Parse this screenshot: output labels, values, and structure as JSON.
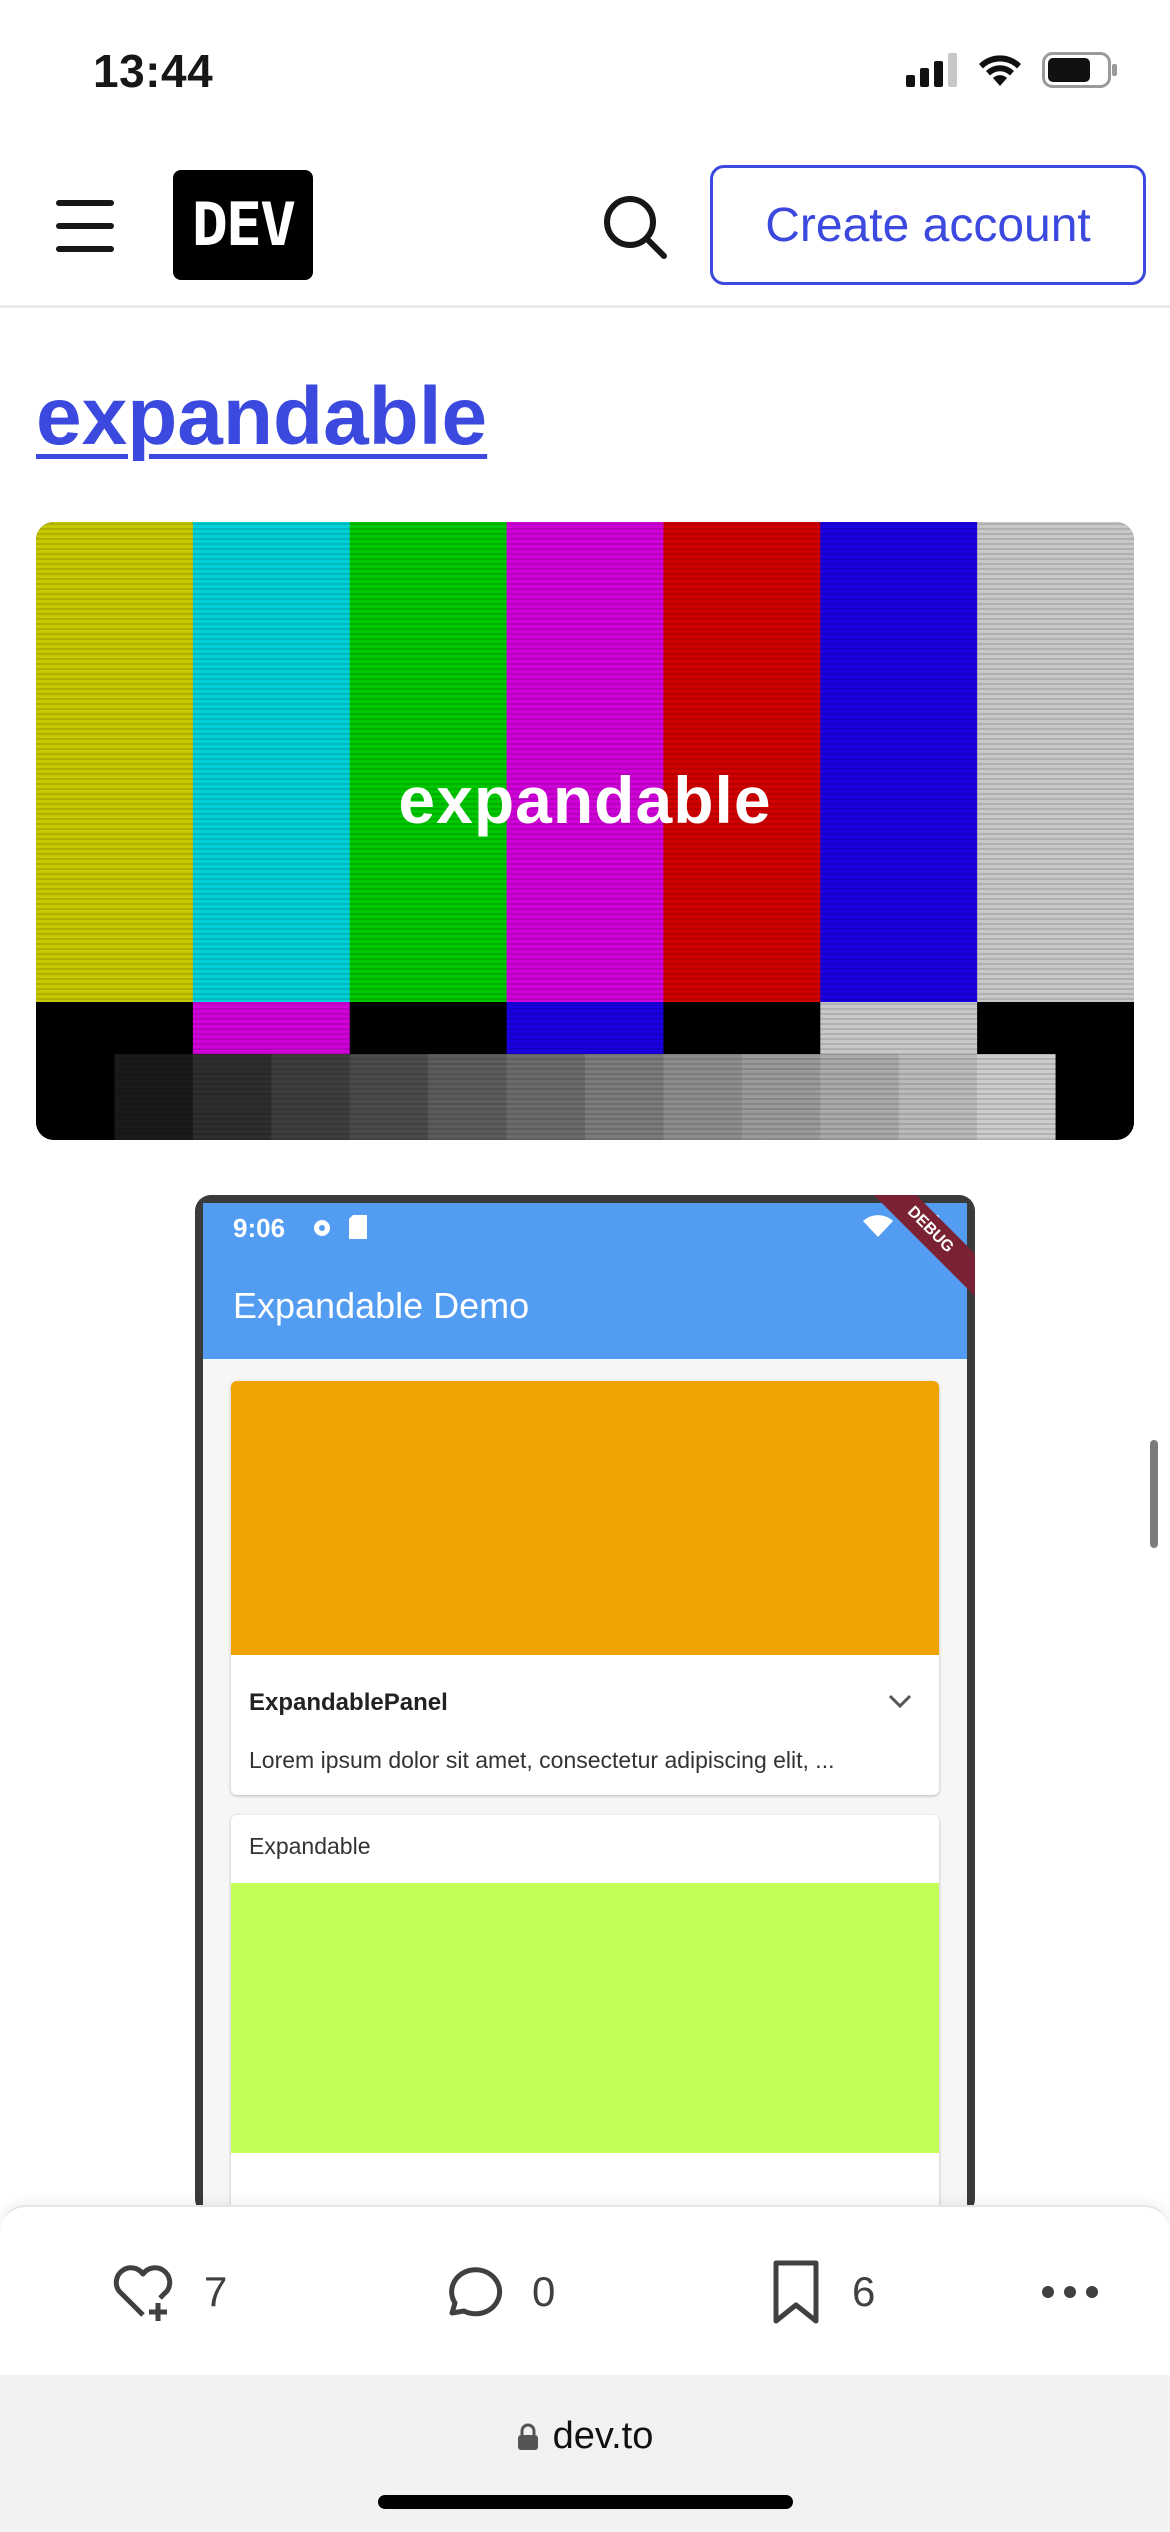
{
  "status_bar": {
    "time": "13:44"
  },
  "header": {
    "logo_text": "DEV",
    "create_account_label": "Create account"
  },
  "article": {
    "heading": "expandable",
    "cover": {
      "text": "expandable",
      "top_bars": [
        "#c8c800",
        "#00d0d8",
        "#00c800",
        "#d000d8",
        "#d00000",
        "#1a00e0",
        "#c8c8c8"
      ],
      "middle_bars": [
        "#000000",
        "#d000d8",
        "#000000",
        "#1a00e0",
        "#000000",
        "#c8c8c8",
        "#000000"
      ],
      "bottom_steps": [
        "#000000",
        "#1a1a1a",
        "#2e2e2e",
        "#3d3d3d",
        "#4b4b4b",
        "#5c5c5c",
        "#6b6b6b",
        "#7b7b7b",
        "#8c8c8c",
        "#9a9a9a",
        "#a9a9a9",
        "#bababa",
        "#cccccc",
        "#000000"
      ]
    },
    "demo": {
      "time": "9:06",
      "app_title": "Expandable Demo",
      "debug_label": "DEBUG",
      "panel_title": "ExpandablePanel",
      "panel_text": "Lorem ipsum dolor sit amet, consectetur adipiscing elit, ...",
      "card2_label": "Expandable"
    }
  },
  "reactions": {
    "likes": "7",
    "comments": "0",
    "bookmarks": "6"
  },
  "browser": {
    "url": "dev.to"
  },
  "colors": {
    "accent": "#3b49df",
    "orange": "#efa200",
    "lime": "#c2ff57",
    "app_bar": "#529df1"
  }
}
